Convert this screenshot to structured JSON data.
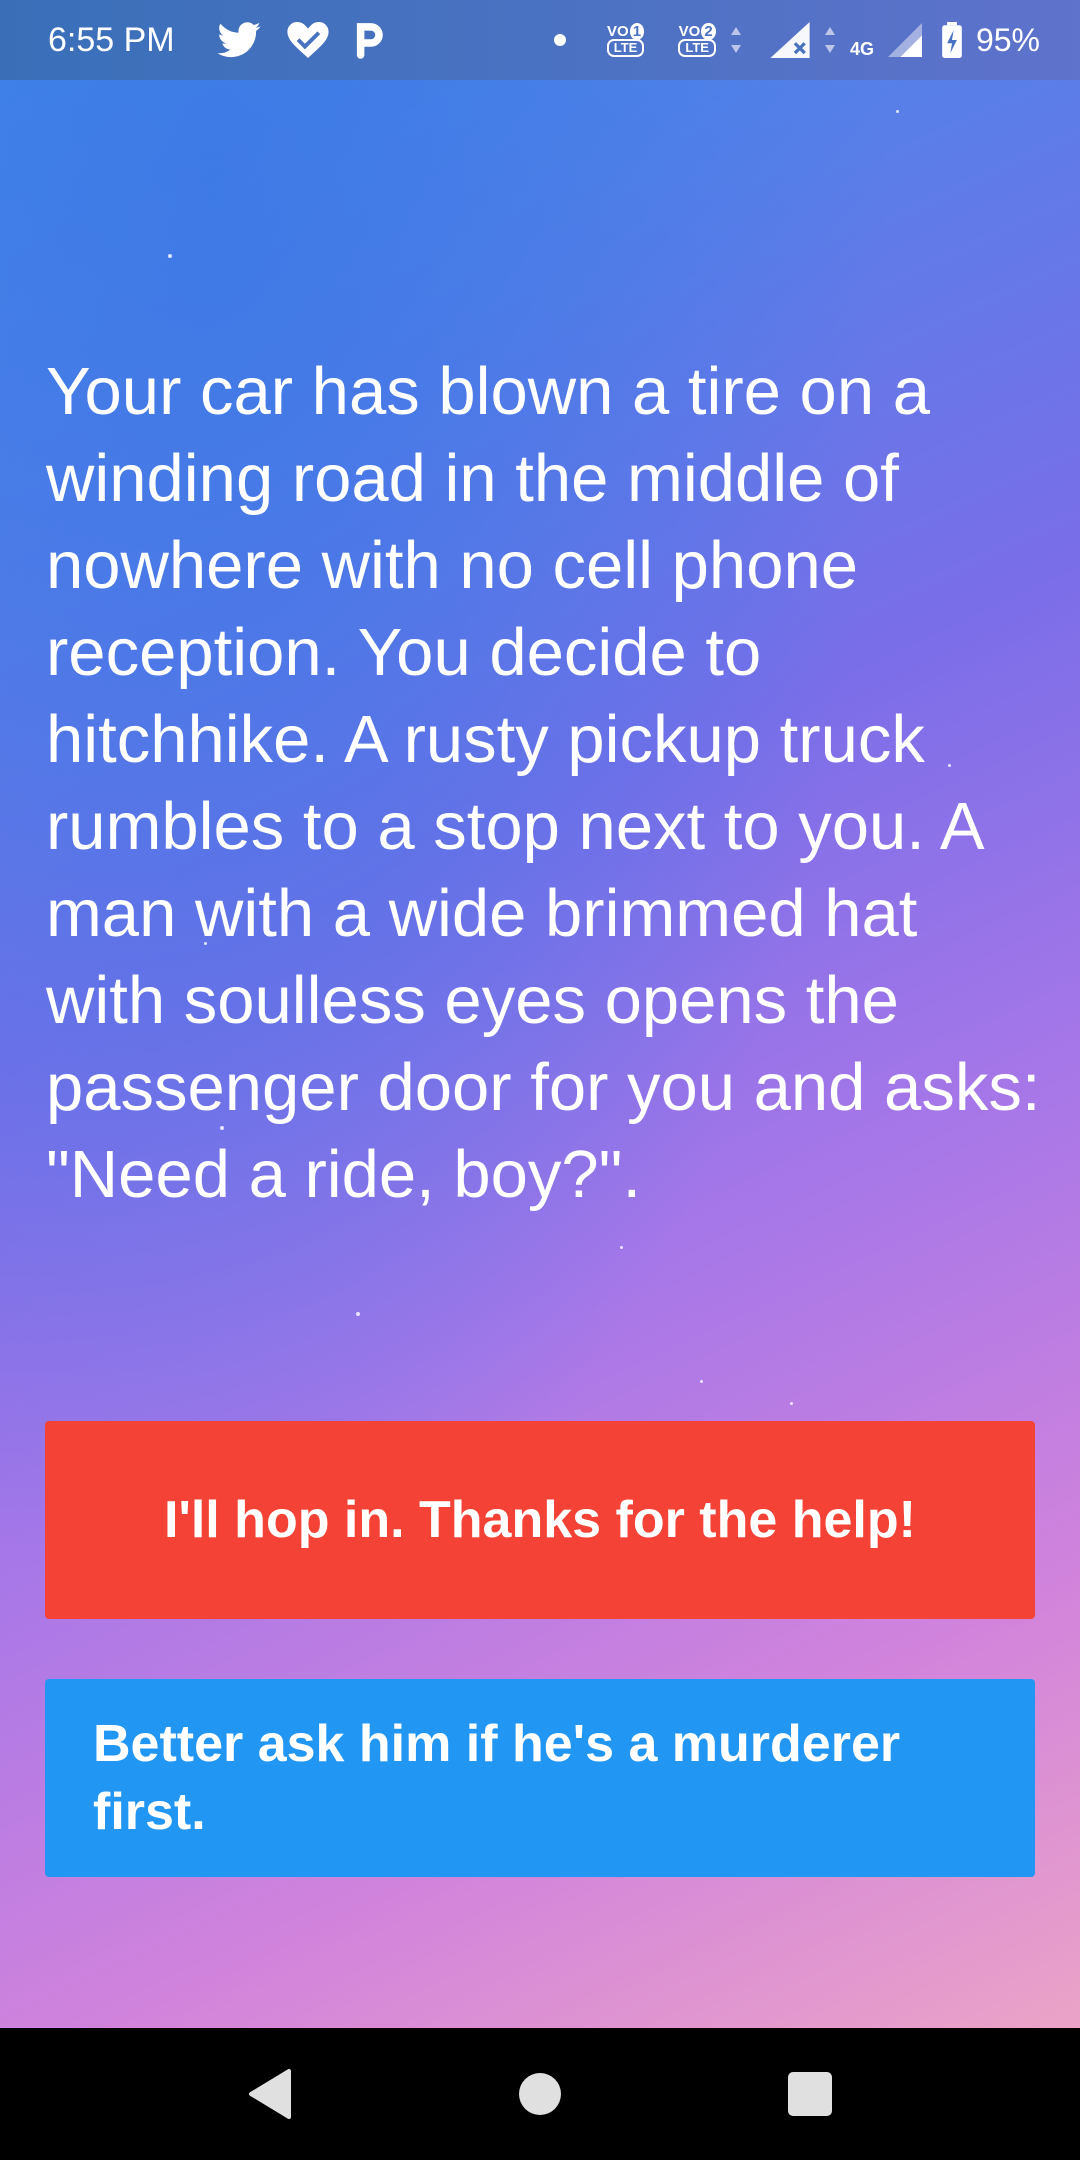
{
  "status_bar": {
    "time": "6:55 PM",
    "notification_icons": [
      "twitter-icon",
      "heart-check-icon",
      "p-app-icon"
    ],
    "sim1_label": "VO",
    "sim1_badge": "1",
    "sim1_sub": "LTE",
    "sim2_label": "VO",
    "sim2_badge": "2",
    "sim2_sub": "LTE",
    "network": "4G",
    "battery": "95%"
  },
  "story": {
    "text": "Your car has blown a tire on a winding road in the middle of nowhere with no cell phone reception. You decide to hitchhike. A rusty pickup truck rumbles to a stop next to you. A man with a wide brimmed hat with soulless eyes opens the passenger door for you and asks: \"Need a ride, boy?\"."
  },
  "choices": [
    {
      "label": "I'll hop in. Thanks for the help!",
      "color": "#f44336"
    },
    {
      "label": "Better ask him if he's a murderer first.",
      "color": "#2196f3"
    }
  ],
  "nav": {
    "icons": [
      "back-icon",
      "home-icon",
      "recents-icon"
    ]
  }
}
